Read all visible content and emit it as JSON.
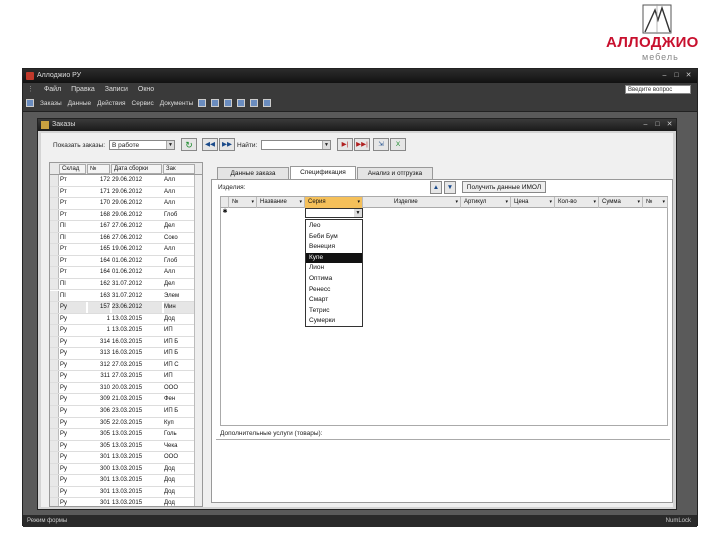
{
  "logo": {
    "text": "АЛЛОДЖИО",
    "sub": "мебель"
  },
  "app": {
    "title": "Аллоджио РУ"
  },
  "menu": [
    "Файл",
    "Правка",
    "Записи",
    "Окно"
  ],
  "menu_combo": "Введите вопрос",
  "toolbar": [
    "Заказы",
    "Данные",
    "Действия",
    "Сервис",
    "Документы"
  ],
  "form": {
    "title": "Заказы"
  },
  "filters": {
    "label_status": "Показать заказы:",
    "status_value": "В работе",
    "label_find": "Найти:",
    "find_value": ""
  },
  "left_grid": {
    "headers": [
      "Склад",
      "№",
      "Дата сборки",
      "Зак"
    ],
    "rows": [
      [
        "Рт",
        "172",
        "29.06.2012",
        "Алл"
      ],
      [
        "Рт",
        "171",
        "29.06.2012",
        "Алл"
      ],
      [
        "Рт",
        "170",
        "29.06.2012",
        "Алл"
      ],
      [
        "Рт",
        "168",
        "29.06.2012",
        "Глоб"
      ],
      [
        "Пl",
        "167",
        "27.06.2012",
        "Дел"
      ],
      [
        "Пl",
        "166",
        "27.06.2012",
        "Соко"
      ],
      [
        "Рт",
        "165",
        "19.06.2012",
        "Алл"
      ],
      [
        "Рт",
        "164",
        "01.06.2012",
        "Глоб"
      ],
      [
        "Рт",
        "164",
        "01.06.2012",
        "Алл"
      ],
      [
        "Пl",
        "162",
        "31.07.2012",
        "Дел"
      ],
      [
        "Пl",
        "163",
        "31.07.2012",
        "Элем"
      ],
      [
        "Ру",
        "157",
        "23.06.2012",
        "Мин"
      ],
      [
        "Ру",
        "1",
        "13.03.2015",
        "Дод"
      ],
      [
        "Ру",
        "1",
        "13.03.2015",
        "ИП"
      ],
      [
        "Ру",
        "314",
        "16.03.2015",
        "ИП Б"
      ],
      [
        "Ру",
        "313",
        "16.03.2015",
        "ИП Б"
      ],
      [
        "Ру",
        "312",
        "27.03.2015",
        "ИП С"
      ],
      [
        "Ру",
        "311",
        "27.03.2015",
        "ИП"
      ],
      [
        "Ру",
        "310",
        "20.03.2015",
        "ООО"
      ],
      [
        "Ру",
        "309",
        "21.03.2015",
        "Фен"
      ],
      [
        "Ру",
        "306",
        "23.03.2015",
        "ИП Б"
      ],
      [
        "Ру",
        "305",
        "22.03.2015",
        "Куп"
      ],
      [
        "Ру",
        "305",
        "13.03.2015",
        "Голь"
      ],
      [
        "Ру",
        "305",
        "13.03.2015",
        "Чека"
      ],
      [
        "Ру",
        "301",
        "13.03.2015",
        "ООО"
      ],
      [
        "Ру",
        "300",
        "13.03.2015",
        "Дод"
      ],
      [
        "Ру",
        "301",
        "13.03.2015",
        "Дод"
      ],
      [
        "Ру",
        "301",
        "13.03.2015",
        "Дод"
      ],
      [
        "Ру",
        "301",
        "13.03.2015",
        "Дод"
      ]
    ]
  },
  "tabs": [
    "Данные заказа",
    "Спецификация",
    "Анализ и отгрузка"
  ],
  "spec": {
    "label_items": "Изделия:",
    "fetch_button": "Получить данные ИМОЛ",
    "headers": [
      "№",
      "Название",
      "Серия",
      "Изделие",
      "Артикул",
      "Цена",
      "Кол-во",
      "Сумма",
      "№"
    ],
    "dropdown": [
      "Лео",
      "Беби Бум",
      "Венеция",
      "Купе",
      "Лион",
      "Оптима",
      "Ренесс",
      "Смарт",
      "Тетрис",
      "Сумерки"
    ],
    "dropdown_selected": "Купе",
    "bottom_label": "Дополнительные услуги (товары):"
  },
  "status": {
    "left": "Режим формы",
    "right": "NumLock"
  }
}
